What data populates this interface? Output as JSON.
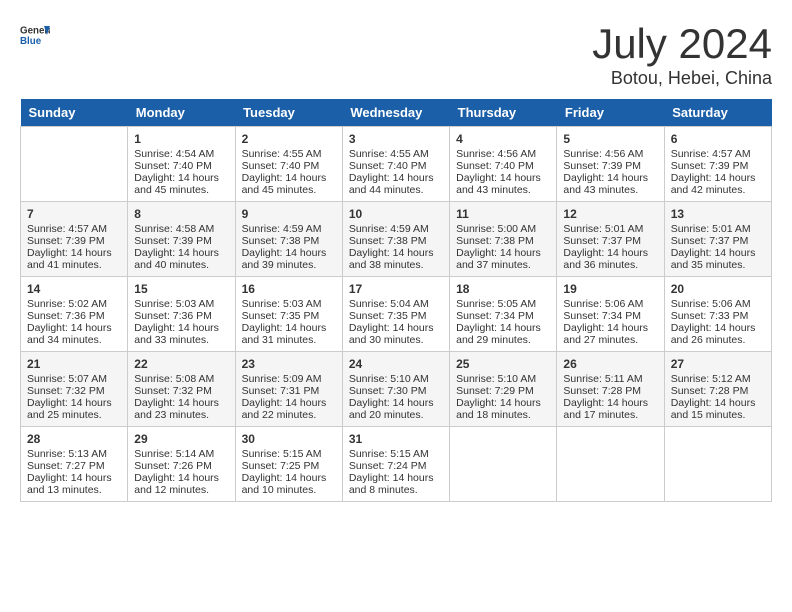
{
  "header": {
    "logo_line1": "General",
    "logo_line2": "Blue",
    "title": "July 2024",
    "subtitle": "Botou, Hebei, China"
  },
  "days_of_week": [
    "Sunday",
    "Monday",
    "Tuesday",
    "Wednesday",
    "Thursday",
    "Friday",
    "Saturday"
  ],
  "weeks": [
    [
      {
        "day": "",
        "info": ""
      },
      {
        "day": "1",
        "info": "Sunrise: 4:54 AM\nSunset: 7:40 PM\nDaylight: 14 hours\nand 45 minutes."
      },
      {
        "day": "2",
        "info": "Sunrise: 4:55 AM\nSunset: 7:40 PM\nDaylight: 14 hours\nand 45 minutes."
      },
      {
        "day": "3",
        "info": "Sunrise: 4:55 AM\nSunset: 7:40 PM\nDaylight: 14 hours\nand 44 minutes."
      },
      {
        "day": "4",
        "info": "Sunrise: 4:56 AM\nSunset: 7:40 PM\nDaylight: 14 hours\nand 43 minutes."
      },
      {
        "day": "5",
        "info": "Sunrise: 4:56 AM\nSunset: 7:39 PM\nDaylight: 14 hours\nand 43 minutes."
      },
      {
        "day": "6",
        "info": "Sunrise: 4:57 AM\nSunset: 7:39 PM\nDaylight: 14 hours\nand 42 minutes."
      }
    ],
    [
      {
        "day": "7",
        "info": "Sunrise: 4:57 AM\nSunset: 7:39 PM\nDaylight: 14 hours\nand 41 minutes."
      },
      {
        "day": "8",
        "info": "Sunrise: 4:58 AM\nSunset: 7:39 PM\nDaylight: 14 hours\nand 40 minutes."
      },
      {
        "day": "9",
        "info": "Sunrise: 4:59 AM\nSunset: 7:38 PM\nDaylight: 14 hours\nand 39 minutes."
      },
      {
        "day": "10",
        "info": "Sunrise: 4:59 AM\nSunset: 7:38 PM\nDaylight: 14 hours\nand 38 minutes."
      },
      {
        "day": "11",
        "info": "Sunrise: 5:00 AM\nSunset: 7:38 PM\nDaylight: 14 hours\nand 37 minutes."
      },
      {
        "day": "12",
        "info": "Sunrise: 5:01 AM\nSunset: 7:37 PM\nDaylight: 14 hours\nand 36 minutes."
      },
      {
        "day": "13",
        "info": "Sunrise: 5:01 AM\nSunset: 7:37 PM\nDaylight: 14 hours\nand 35 minutes."
      }
    ],
    [
      {
        "day": "14",
        "info": "Sunrise: 5:02 AM\nSunset: 7:36 PM\nDaylight: 14 hours\nand 34 minutes."
      },
      {
        "day": "15",
        "info": "Sunrise: 5:03 AM\nSunset: 7:36 PM\nDaylight: 14 hours\nand 33 minutes."
      },
      {
        "day": "16",
        "info": "Sunrise: 5:03 AM\nSunset: 7:35 PM\nDaylight: 14 hours\nand 31 minutes."
      },
      {
        "day": "17",
        "info": "Sunrise: 5:04 AM\nSunset: 7:35 PM\nDaylight: 14 hours\nand 30 minutes."
      },
      {
        "day": "18",
        "info": "Sunrise: 5:05 AM\nSunset: 7:34 PM\nDaylight: 14 hours\nand 29 minutes."
      },
      {
        "day": "19",
        "info": "Sunrise: 5:06 AM\nSunset: 7:34 PM\nDaylight: 14 hours\nand 27 minutes."
      },
      {
        "day": "20",
        "info": "Sunrise: 5:06 AM\nSunset: 7:33 PM\nDaylight: 14 hours\nand 26 minutes."
      }
    ],
    [
      {
        "day": "21",
        "info": "Sunrise: 5:07 AM\nSunset: 7:32 PM\nDaylight: 14 hours\nand 25 minutes."
      },
      {
        "day": "22",
        "info": "Sunrise: 5:08 AM\nSunset: 7:32 PM\nDaylight: 14 hours\nand 23 minutes."
      },
      {
        "day": "23",
        "info": "Sunrise: 5:09 AM\nSunset: 7:31 PM\nDaylight: 14 hours\nand 22 minutes."
      },
      {
        "day": "24",
        "info": "Sunrise: 5:10 AM\nSunset: 7:30 PM\nDaylight: 14 hours\nand 20 minutes."
      },
      {
        "day": "25",
        "info": "Sunrise: 5:10 AM\nSunset: 7:29 PM\nDaylight: 14 hours\nand 18 minutes."
      },
      {
        "day": "26",
        "info": "Sunrise: 5:11 AM\nSunset: 7:28 PM\nDaylight: 14 hours\nand 17 minutes."
      },
      {
        "day": "27",
        "info": "Sunrise: 5:12 AM\nSunset: 7:28 PM\nDaylight: 14 hours\nand 15 minutes."
      }
    ],
    [
      {
        "day": "28",
        "info": "Sunrise: 5:13 AM\nSunset: 7:27 PM\nDaylight: 14 hours\nand 13 minutes."
      },
      {
        "day": "29",
        "info": "Sunrise: 5:14 AM\nSunset: 7:26 PM\nDaylight: 14 hours\nand 12 minutes."
      },
      {
        "day": "30",
        "info": "Sunrise: 5:15 AM\nSunset: 7:25 PM\nDaylight: 14 hours\nand 10 minutes."
      },
      {
        "day": "31",
        "info": "Sunrise: 5:15 AM\nSunset: 7:24 PM\nDaylight: 14 hours\nand 8 minutes."
      },
      {
        "day": "",
        "info": ""
      },
      {
        "day": "",
        "info": ""
      },
      {
        "day": "",
        "info": ""
      }
    ]
  ]
}
